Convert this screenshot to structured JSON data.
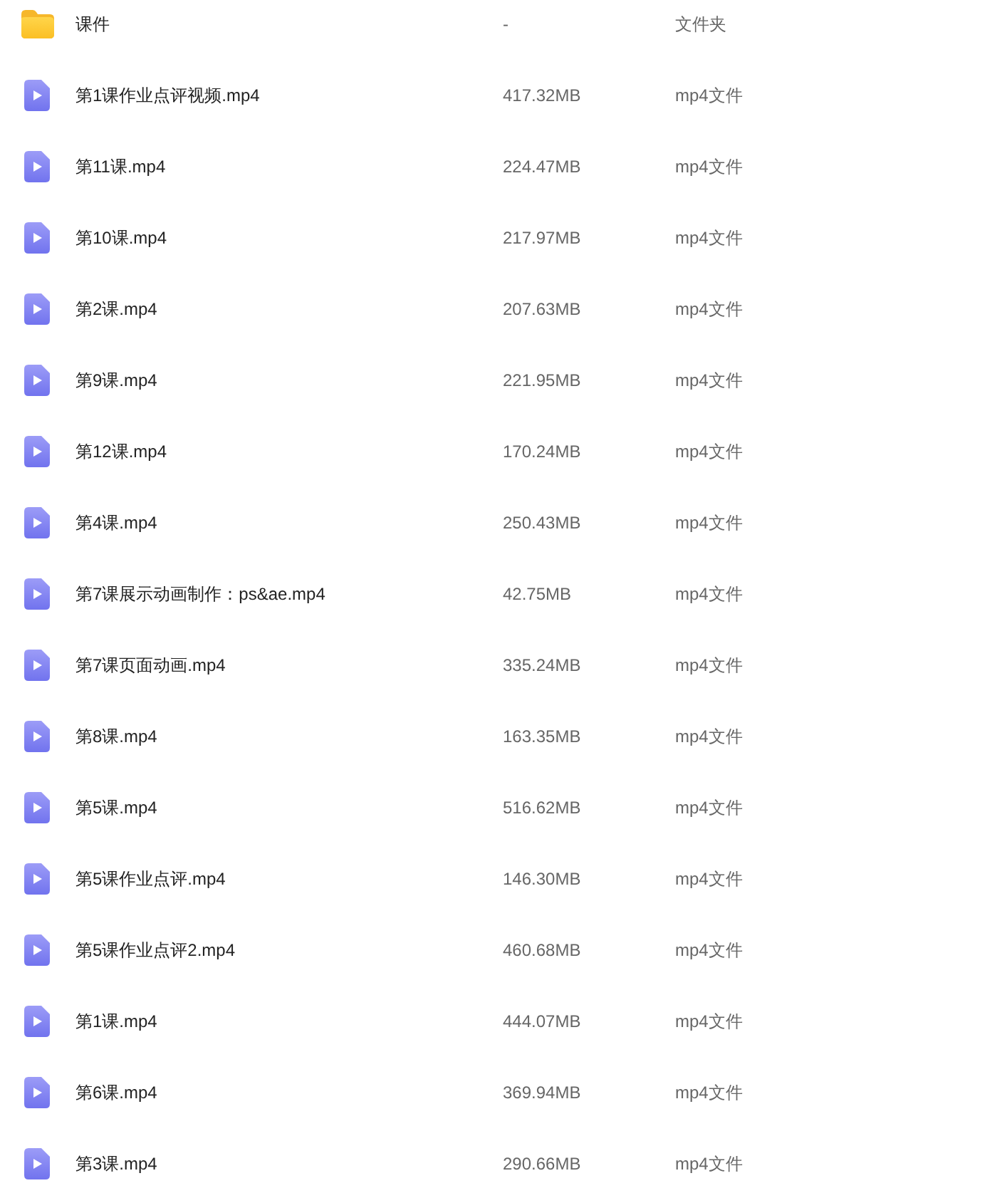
{
  "files": [
    {
      "kind": "folder",
      "name": "课件",
      "size": "-",
      "type": "文件夹"
    },
    {
      "kind": "video",
      "name": "第1课作业点评视频.mp4",
      "size": "417.32MB",
      "type": "mp4文件"
    },
    {
      "kind": "video",
      "name": "第11课.mp4",
      "size": "224.47MB",
      "type": "mp4文件"
    },
    {
      "kind": "video",
      "name": "第10课.mp4",
      "size": "217.97MB",
      "type": "mp4文件"
    },
    {
      "kind": "video",
      "name": "第2课.mp4",
      "size": "207.63MB",
      "type": "mp4文件"
    },
    {
      "kind": "video",
      "name": "第9课.mp4",
      "size": "221.95MB",
      "type": "mp4文件"
    },
    {
      "kind": "video",
      "name": "第12课.mp4",
      "size": "170.24MB",
      "type": "mp4文件"
    },
    {
      "kind": "video",
      "name": "第4课.mp4",
      "size": "250.43MB",
      "type": "mp4文件"
    },
    {
      "kind": "video",
      "name": "第7课展示动画制作：ps&ae.mp4",
      "size": "42.75MB",
      "type": "mp4文件"
    },
    {
      "kind": "video",
      "name": "第7课页面动画.mp4",
      "size": "335.24MB",
      "type": "mp4文件"
    },
    {
      "kind": "video",
      "name": "第8课.mp4",
      "size": "163.35MB",
      "type": "mp4文件"
    },
    {
      "kind": "video",
      "name": "第5课.mp4",
      "size": "516.62MB",
      "type": "mp4文件"
    },
    {
      "kind": "video",
      "name": "第5课作业点评.mp4",
      "size": "146.30MB",
      "type": "mp4文件"
    },
    {
      "kind": "video",
      "name": "第5课作业点评2.mp4",
      "size": "460.68MB",
      "type": "mp4文件"
    },
    {
      "kind": "video",
      "name": "第1课.mp4",
      "size": "444.07MB",
      "type": "mp4文件"
    },
    {
      "kind": "video",
      "name": "第6课.mp4",
      "size": "369.94MB",
      "type": "mp4文件"
    },
    {
      "kind": "video",
      "name": "第3课.mp4",
      "size": "290.66MB",
      "type": "mp4文件"
    }
  ]
}
